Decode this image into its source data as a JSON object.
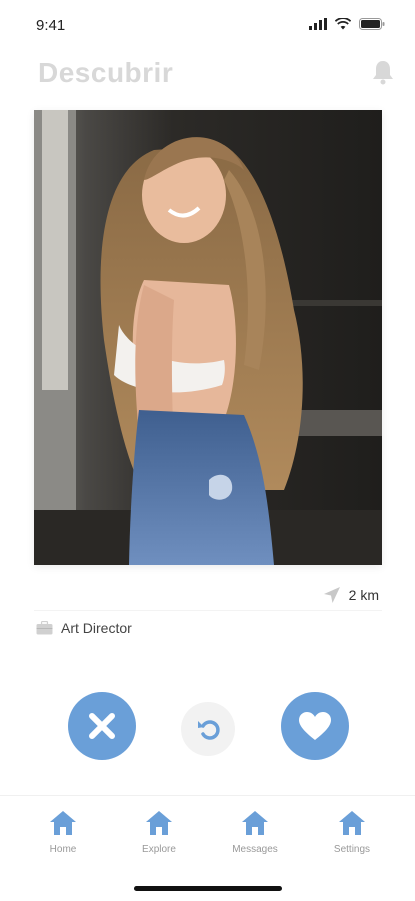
{
  "status_bar": {
    "time": "9:41"
  },
  "header": {
    "title": "Descubrir",
    "bell_icon": "bell-icon"
  },
  "profile": {
    "photo_alt": "profile-photo",
    "distance": "2 km",
    "distance_icon": "location-arrow-icon",
    "job": "Art Director",
    "job_icon": "briefcase-icon"
  },
  "actions": {
    "nope_icon": "close-icon",
    "undo_icon": "undo-icon",
    "like_icon": "heart-icon"
  },
  "tabs": [
    {
      "label": "Home",
      "icon": "home-icon"
    },
    {
      "label": "Explore",
      "icon": "home-icon"
    },
    {
      "label": "Messages",
      "icon": "home-icon"
    },
    {
      "label": "Settings",
      "icon": "home-icon"
    }
  ],
  "colors": {
    "accent": "#6a9fd8",
    "title": "#d8d8d8",
    "tab_label": "#999999"
  }
}
